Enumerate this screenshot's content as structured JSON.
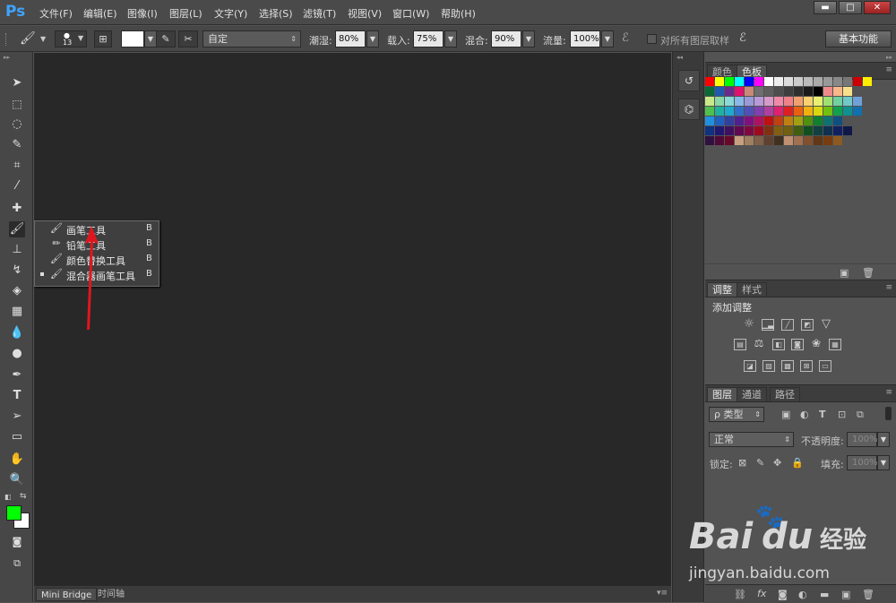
{
  "app": {
    "logo": "Ps"
  },
  "menu": [
    "文件(F)",
    "编辑(E)",
    "图像(I)",
    "图层(L)",
    "文字(Y)",
    "选择(S)",
    "滤镜(T)",
    "视图(V)",
    "窗口(W)",
    "帮助(H)"
  ],
  "window_controls": {
    "minimize": "▬",
    "maximize": "□",
    "close": "✕"
  },
  "options_bar": {
    "brush_size": "13",
    "preset": "自定",
    "wetness_label": "潮湿:",
    "wetness_value": "80%",
    "load_label": "载入:",
    "load_value": "75%",
    "mix_label": "混合:",
    "mix_value": "90%",
    "flow_label": "流量:",
    "flow_value": "100%",
    "sample_all_label": "对所有图层取样",
    "workspace": "基本功能"
  },
  "flyout": {
    "items": [
      {
        "label": "画笔工具",
        "key": "B"
      },
      {
        "label": "铅笔工具",
        "key": "B"
      },
      {
        "label": "颜色替换工具",
        "key": "B"
      },
      {
        "label": "混合器画笔工具",
        "key": "B",
        "selected": true
      }
    ]
  },
  "colors": {
    "foreground": "#00ff00",
    "background": "#ffffff",
    "arrow": "#e0161f"
  },
  "bottom_tabs": [
    "Mini Bridge",
    "时间轴"
  ],
  "swatches_panel": {
    "tabs": [
      "颜色",
      "色板"
    ]
  },
  "adjustments_panel": {
    "tabs": [
      "调整",
      "样式"
    ],
    "title": "添加调整"
  },
  "layers_panel": {
    "tabs": [
      "图层",
      "通道",
      "路径"
    ],
    "filter_kind": "ρ 类型",
    "blend_mode": "正常",
    "opacity_label": "不透明度:",
    "opacity_value": "100%",
    "lock_label": "锁定:",
    "fill_label": "填充:",
    "fill_value": "100%"
  },
  "watermark": {
    "brand": "Bai",
    "brand2": "du",
    "cn": "经验",
    "url": "jingyan.baidu.com"
  }
}
